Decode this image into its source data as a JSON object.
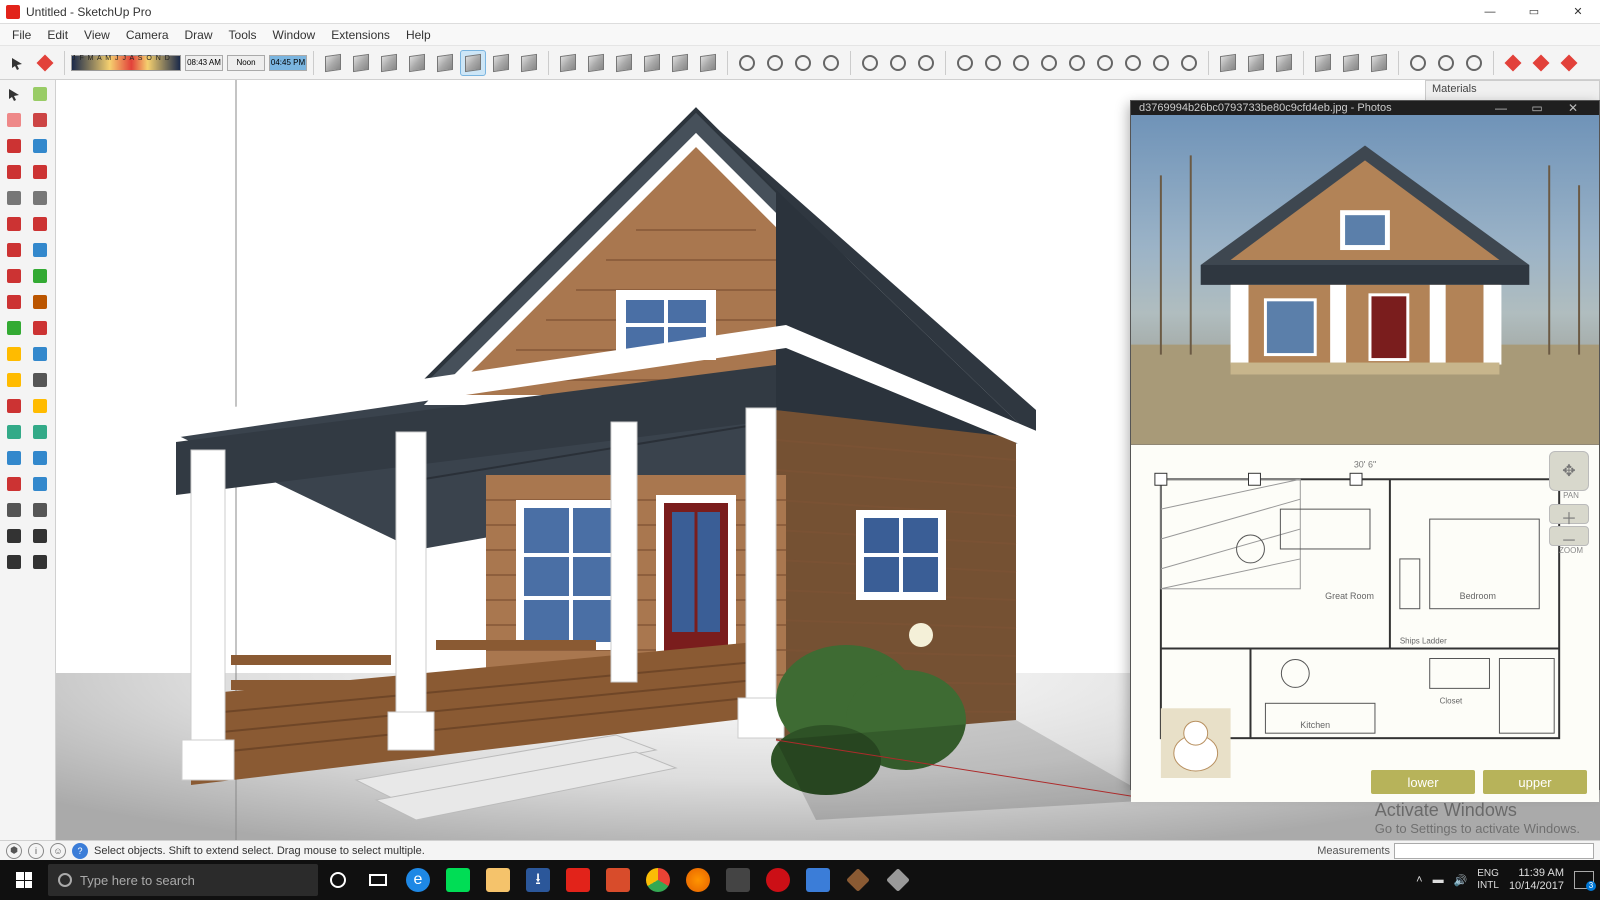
{
  "window": {
    "title": "Untitled - SketchUp Pro",
    "controls": {
      "min": "—",
      "max": "▭",
      "close": "✕"
    }
  },
  "menu": [
    "File",
    "Edit",
    "View",
    "Camera",
    "Draw",
    "Tools",
    "Window",
    "Extensions",
    "Help"
  ],
  "time_strip": {
    "months": "J F M A M J J A S O N D",
    "t1": "08:43 AM",
    "noon": "Noon",
    "t2": "04:45 PM"
  },
  "materials_panel": {
    "title": "Materials"
  },
  "photos_window": {
    "title": "d3769994b26bc0793733be80c9cfd4eb.jpg - Photos",
    "controls": {
      "min": "—",
      "max": "▭",
      "close": "✕"
    },
    "plan_dimension": "30' 6\"",
    "rooms": {
      "great": "Great Room",
      "bedroom": "Bedroom",
      "kitchen": "Kitchen",
      "closet": "Closet",
      "ladder": "Ships Ladder"
    },
    "buttons": {
      "lower": "lower",
      "upper": "upper"
    },
    "side_labels": {
      "pan": "PAN",
      "zoom": "ZOOM"
    }
  },
  "activation": {
    "heading": "Activate Windows",
    "sub": "Go to Settings to activate Windows."
  },
  "statusbar": {
    "hint": "Select objects. Shift to extend select. Drag mouse to select multiple.",
    "measurements_label": "Measurements"
  },
  "taskbar": {
    "search_placeholder": "Type here to search",
    "lang1": "ENG",
    "lang2": "INTL",
    "time": "11:39 AM",
    "date": "10/14/2017",
    "notif_count": "3"
  },
  "top_tool_names": [
    "select-context",
    "paint-bucket",
    "months-strip",
    "time-start",
    "noon",
    "time-end",
    "iso",
    "top",
    "front",
    "right",
    "back",
    "left",
    "perspective",
    "two-point",
    "component-make",
    "component-edit",
    "home",
    "warehouse",
    "reload",
    "upload",
    "section-plane",
    "section-display",
    "section-fill",
    "section-cut",
    "shadow-settings",
    "fog",
    "xray",
    "hidden-geometry",
    "axes",
    "circle-a",
    "circle-b",
    "circle-c",
    "circle-d",
    "circle-e",
    "sun-a",
    "sun-b",
    "sun-c",
    "sun-d",
    "ext-1",
    "ext-2",
    "ext-3",
    "ext-4",
    "ext-5",
    "ext-6",
    "ext-7",
    "ext-8",
    "ext-9",
    "plant-1",
    "plant-2",
    "plant-3"
  ],
  "left_tool_names": [
    "select",
    "make-component",
    "eraser",
    "paint-bucket",
    "line",
    "freehand",
    "rectangle",
    "rotated-rect",
    "circle",
    "polygon",
    "arc",
    "two-point-arc",
    "pie",
    "bezier",
    "move",
    "rotate",
    "scale",
    "push-pull",
    "follow-me",
    "offset",
    "tape",
    "dimension",
    "text",
    "3d-text",
    "axes-tool",
    "protractor",
    "orbit-tool",
    "pan-tool",
    "zoom",
    "zoom-window",
    "zoom-extents",
    "previous-view",
    "position-camera",
    "look-around",
    "walk",
    "section",
    "layers",
    "outliner"
  ]
}
